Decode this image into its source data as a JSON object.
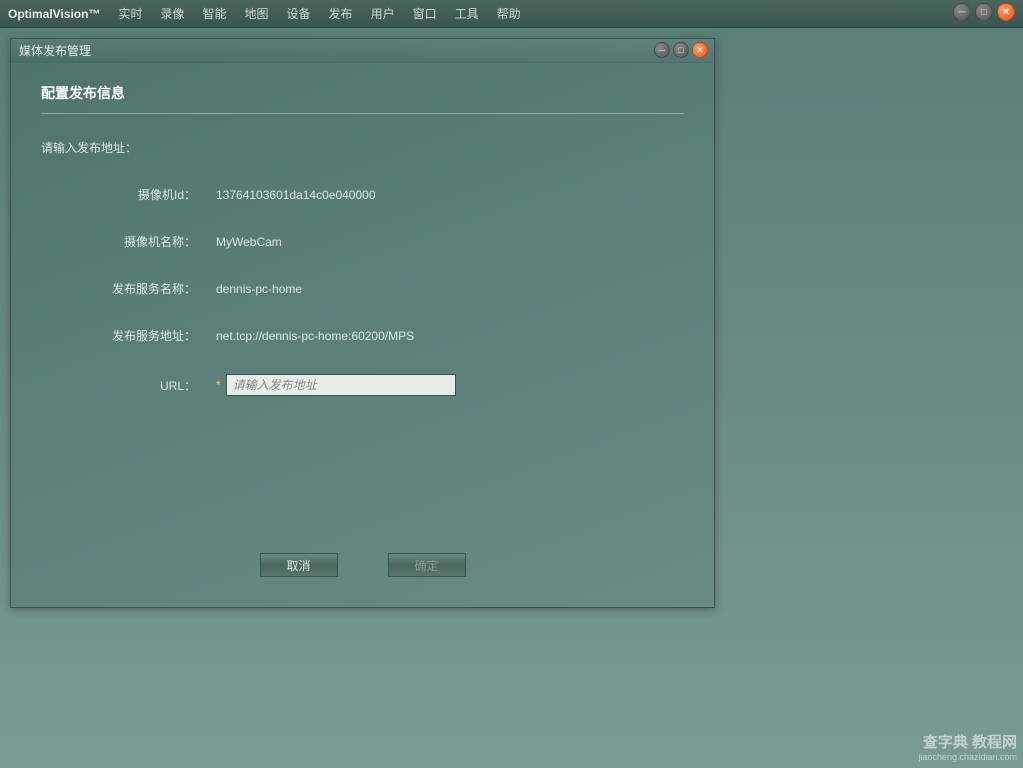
{
  "app": {
    "brand": "OptimalVision™"
  },
  "menu": {
    "items": [
      "实时",
      "录像",
      "智能",
      "地图",
      "设备",
      "发布",
      "用户",
      "窗口",
      "工具",
      "帮助"
    ]
  },
  "dialog": {
    "title": "媒体发布管理",
    "heading": "配置发布信息",
    "prompt": "请输入发布地址：",
    "fields": {
      "camera_id": {
        "label": "摄像机Id：",
        "value": "13764103601da14c0e040000"
      },
      "camera_name": {
        "label": "摄像机名称：",
        "value": "MyWebCam"
      },
      "publish_service_name": {
        "label": "发布服务名称：",
        "value": "dennis-pc-home"
      },
      "publish_service_address": {
        "label": "发布服务地址：",
        "value": "net.tcp://dennis-pc-home:60200/MPS"
      },
      "url": {
        "label": "URL：",
        "required_mark": "*",
        "placeholder": "请输入发布地址",
        "value": ""
      }
    },
    "buttons": {
      "cancel": "取消",
      "ok": "确定"
    }
  },
  "watermark": {
    "main": "查字典 教程网",
    "sub": "jiaocheng.chazidian.com"
  }
}
